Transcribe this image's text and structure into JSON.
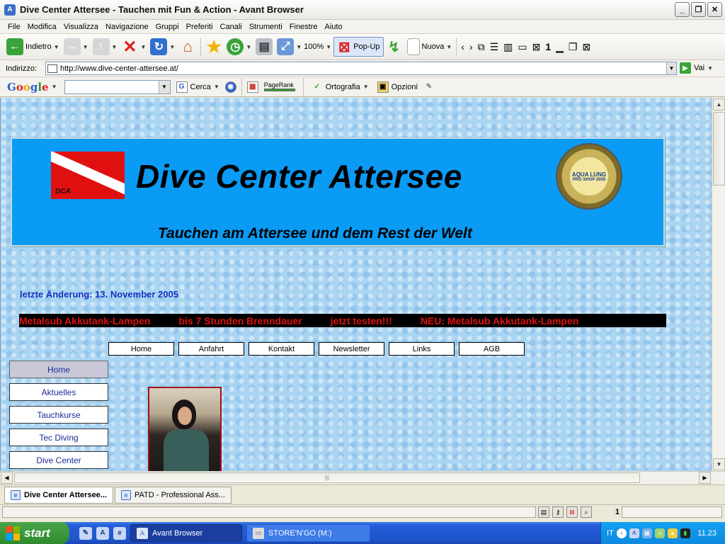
{
  "window": {
    "title": "Dive Center Attersee - Tauchen mit Fun & Action - Avant Browser"
  },
  "menu": [
    "File",
    "Modifica",
    "Visualizza",
    "Navigazione",
    "Gruppi",
    "Preferiti",
    "Canali",
    "Strumenti",
    "Finestre",
    "Aiuto"
  ],
  "toolbar": {
    "back_label": "Indietro",
    "zoom": "100%",
    "popup_label": "Pop-Up",
    "new_label": "Nuova"
  },
  "address": {
    "label": "Indirizzo:",
    "url": "http://www.dive-center-attersee.at/",
    "go_label": "Vai"
  },
  "googlebar": {
    "search_label": "Cerca",
    "pagerank_label": "PageRank",
    "spell_label": "Ortografia",
    "options_label": "Opzioni"
  },
  "page": {
    "banner_title": "Dive Center Attersee",
    "banner_subtitle": "Tauchen am Attersee und dem Rest der Welt",
    "dca_logo_text": "DCA",
    "aqualung_logo": "AQUA LUNG PRO SHOP 2005",
    "last_updated": "letzte Änderung: 13. November 2005",
    "ticker": [
      "Metalsub Akkutank-Lampen",
      "bis 7 Stunden Brenndauer",
      "jetzt testen!!!",
      "NEU: Metalsub Akkutank-Lampen"
    ],
    "top_nav": [
      "Home",
      "Anfahrt",
      "Kontakt",
      "Newsletter",
      "Links",
      "AGB"
    ],
    "side_nav": [
      "Home",
      "Aktuelles",
      "Tauchkurse",
      "Tec Diving",
      "Dive Center"
    ]
  },
  "tabs": [
    "Dive Center Attersee...",
    "PATD - Professional Ass..."
  ],
  "status": {
    "count": "1"
  },
  "taskbar": {
    "start_label": "start",
    "tasks": [
      "Avant Browser",
      "STORE'N'GO (M:)"
    ],
    "lang": "IT",
    "clock": "11.23"
  }
}
